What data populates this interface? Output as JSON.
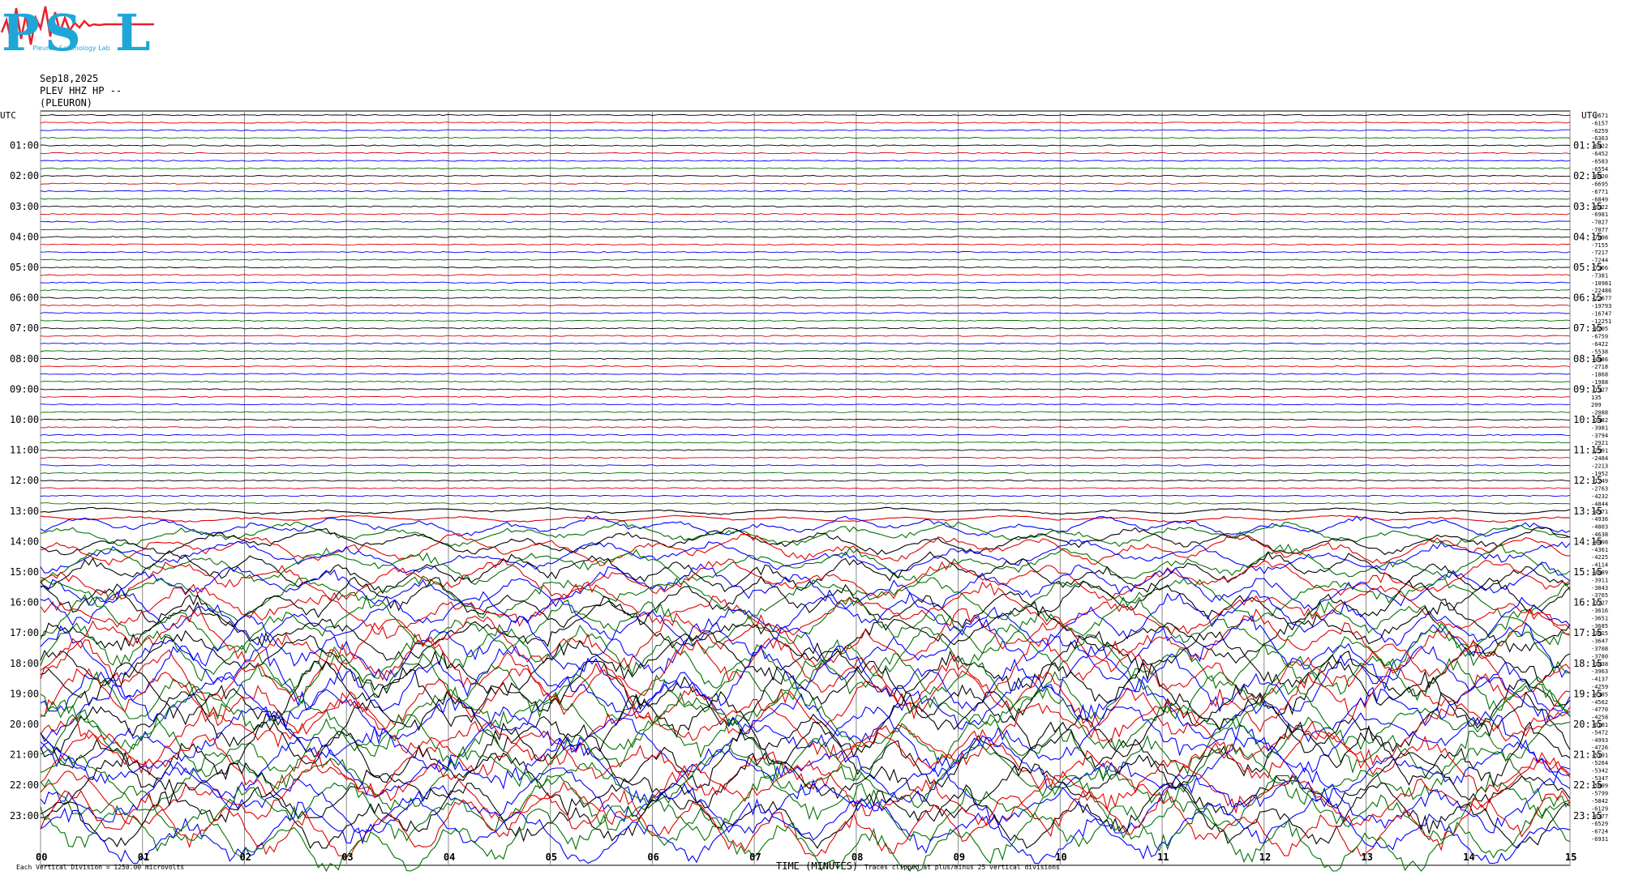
{
  "logo": {
    "letters": [
      "P",
      "S",
      "L"
    ],
    "subtext": "Pleuron Seismology Lab",
    "colors": {
      "letters": "#1fa6d9",
      "wave": "#e8202a"
    }
  },
  "header": {
    "date": "Sep18,2025",
    "channel": "PLEV HHZ HP --",
    "station": "(PLEURON)"
  },
  "footer": {
    "left_note": "Each Vertical Division = 1250.00 microvolts",
    "x_axis_title": "TIME (MINUTES)",
    "right_note": "Traces clipped at plus/minus 25 vertical divisions"
  },
  "chart_data": {
    "type": "line",
    "kind": "helicorder",
    "trace_colors": [
      "#000000",
      "#e00000",
      "#0000ff",
      "#007000"
    ],
    "grid": true,
    "minutes_per_line": 15,
    "line_count": 96,
    "x_ticks": [
      "00",
      "01",
      "02",
      "03",
      "04",
      "05",
      "06",
      "07",
      "08",
      "09",
      "10",
      "11",
      "12",
      "13",
      "14",
      "15"
    ],
    "left_axis_label": "UTC",
    "right_axis_label": "UTC",
    "left_hour_labels": [
      "01:00",
      "02:00",
      "03:00",
      "04:00",
      "05:00",
      "06:00",
      "07:00",
      "08:00",
      "09:00",
      "10:00",
      "11:00",
      "12:00",
      "13:00",
      "14:00",
      "15:00",
      "16:00",
      "17:00",
      "18:00",
      "19:00",
      "20:00",
      "21:00",
      "22:00",
      "23:00"
    ],
    "right_hour_labels": [
      "01:15",
      "02:15",
      "03:15",
      "04:15",
      "05:15",
      "06:15",
      "07:15",
      "08:15",
      "09:15",
      "10:15",
      "11:15",
      "12:15",
      "13:15",
      "14:15",
      "15:15",
      "16:15",
      "17:15",
      "18:15",
      "19:15",
      "20:15",
      "21:15",
      "22:15",
      "23:15"
    ],
    "line_offsets": [
      -8671,
      -6157,
      -6259,
      -6363,
      -6422,
      -6452,
      -6583,
      -6554,
      -6620,
      -6695,
      -6771,
      -6849,
      -6922,
      -6981,
      -7027,
      -7077,
      -7098,
      -7155,
      -7217,
      -7244,
      -7366,
      -7381,
      -10981,
      -22486,
      -22677,
      -19793,
      -16747,
      -12251,
      -8705,
      -6759,
      -6422,
      -5538,
      -4486,
      -2718,
      -1868,
      -1988,
      -1927,
      135,
      209,
      -2088,
      -3482,
      -3981,
      -3794,
      -2921,
      -2591,
      -2484,
      -2213,
      -1952,
      -1749,
      -2763,
      -4232,
      -4844,
      -4971,
      -4936,
      -4803,
      -4638,
      -4498,
      -4361,
      -4225,
      -4114,
      -4089,
      -3911,
      -3843,
      -3765,
      -3727,
      -3616,
      -3651,
      -3685,
      -3615,
      -3647,
      -3708,
      -3780,
      -3838,
      -3963,
      -4137,
      -4259,
      -4385,
      -4562,
      -4770,
      -4258,
      -6181,
      -5472,
      -4993,
      -4726,
      -5191,
      -5264,
      -5342,
      -5347,
      -5609,
      -5799,
      -5842,
      -6129,
      -6377,
      -6529,
      -6724,
      -6931
    ],
    "activity_profile_note": "quiet 00:00-13:00, strong oscillation 13:30-23:45 with clipped traces"
  }
}
